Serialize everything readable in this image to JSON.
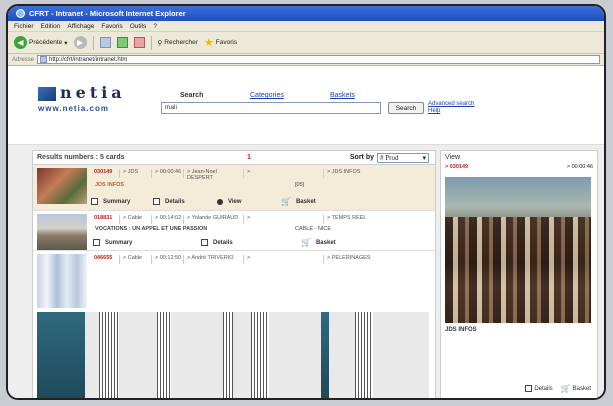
{
  "window": {
    "title": "CFRT - Intranet - Microsoft Internet Explorer"
  },
  "menubar": [
    "Fichier",
    "Edition",
    "Affichage",
    "Favoris",
    "Outils",
    "?"
  ],
  "toolbar": {
    "back_label": "Précédente",
    "search_label": "Rechercher",
    "favorites_label": "Favoris"
  },
  "addressbar": {
    "label": "Adresse",
    "url": "http://cfrt/intranet/intranet.htm"
  },
  "site": {
    "logo_text": "netia",
    "logo_url": "www.netia.com"
  },
  "nav": {
    "search": "Search",
    "categories": "Categories",
    "baskets": "Baskets"
  },
  "search": {
    "value": "mali",
    "button": "Search",
    "advanced": "Advanced search",
    "help": "Help"
  },
  "results": {
    "header": "Results numbers : 5 cards",
    "page": "1",
    "sort_label": "Sort by",
    "sort_value": "# Prod",
    "cards": [
      {
        "id": "030149",
        "type": "> JDS",
        "time": "> 00:00:46",
        "author": "> Jean-Noel DESPERT",
        "extra": ">",
        "tag": "> JDS INFOS",
        "title": "JDS INFOS",
        "code": "[05]"
      },
      {
        "id": "018831",
        "type": "> Cable",
        "time": "> 00:14:02",
        "author": "> Yolande GUIRAUD",
        "extra": ">",
        "tag": "> TEMPS REEL",
        "title": "VOCATIONS : UN APPEL ET UNE PASSION",
        "code": "CABLE - NICE"
      },
      {
        "id": "046655",
        "type": "> Cable",
        "time": "> 00:12:50",
        "author": "> André TRIVERIO",
        "extra": ">",
        "tag": "> PELERINAGES",
        "title": "",
        "code": ""
      }
    ],
    "actions": {
      "summary": "Summary",
      "details": "Details",
      "view": "View",
      "basket": "Basket"
    }
  },
  "viewpanel": {
    "title": "View",
    "id": "> 030149",
    "time": "> 00:00:46",
    "caption": "JDS INFOS",
    "details": "Details",
    "basket": "Basket"
  }
}
